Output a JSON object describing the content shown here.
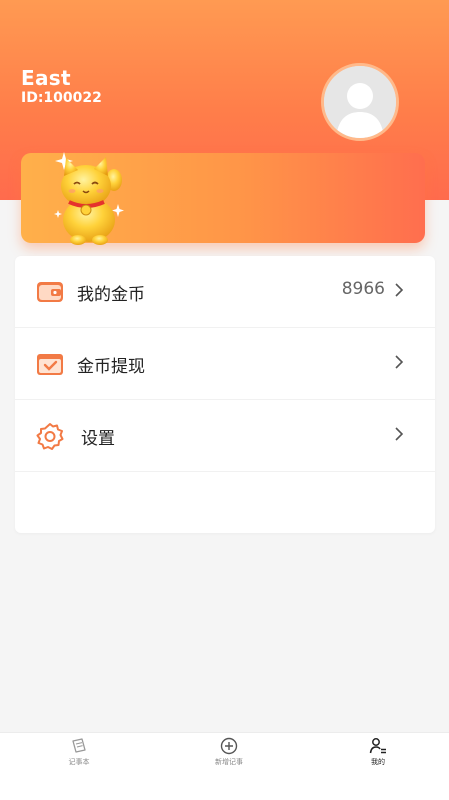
{
  "profile": {
    "name": "East",
    "id_text": "ID:100022"
  },
  "banner": {
    "image": "lucky-cat"
  },
  "menu": {
    "items": [
      {
        "icon": "wallet-icon",
        "label": "我的金币",
        "value": "8966"
      },
      {
        "icon": "withdraw-icon",
        "label": "金币提现",
        "value": ""
      },
      {
        "icon": "gear-icon",
        "label": "设置",
        "value": ""
      }
    ]
  },
  "tabbar": {
    "items": [
      {
        "icon": "notebook-icon",
        "label": "记事本",
        "active": false
      },
      {
        "icon": "plus-circle-icon",
        "label": "新增记事",
        "active": false
      },
      {
        "icon": "profile-icon",
        "label": "我的",
        "active": true
      }
    ]
  },
  "colors": {
    "header_start": "#ff9a52",
    "header_end": "#ff6b4d",
    "icon_orange": "#f27a45",
    "background": "#f5f5f5"
  }
}
